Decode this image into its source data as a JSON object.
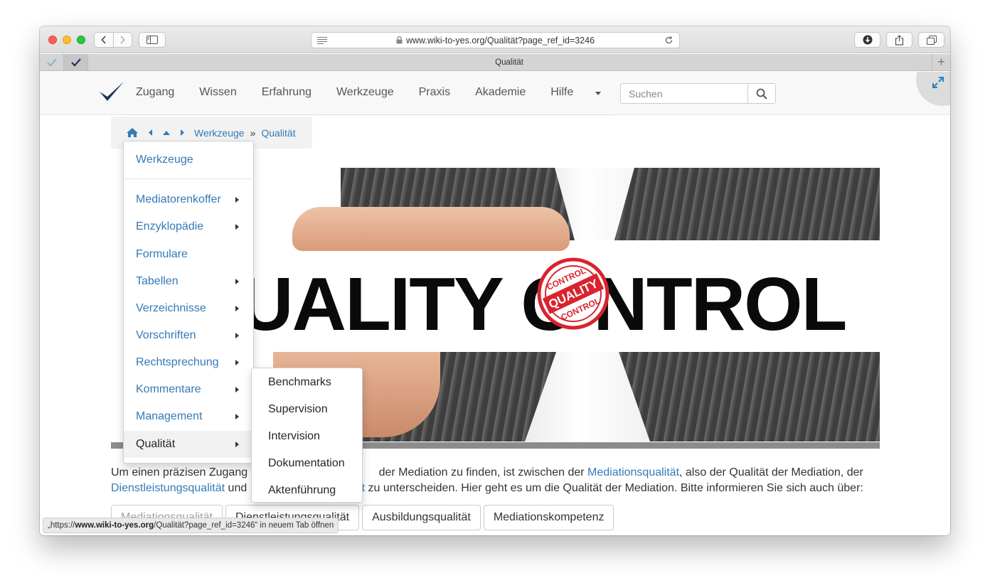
{
  "browser": {
    "url_domain": "www.wiki-to-yes.org",
    "url_path": "/Qualität?page_ref_id=3246",
    "tab_title": "Qualität",
    "new_tab_symbol": "+"
  },
  "site": {
    "menu": [
      "Zugang",
      "Wissen",
      "Erfahrung",
      "Werkzeuge",
      "Praxis",
      "Akademie",
      "Hilfe"
    ],
    "search_placeholder": "Suchen"
  },
  "breadcrumb": {
    "parent": "Werkzeuge",
    "separator": "»",
    "current": "Qualität"
  },
  "dropdown": {
    "header": "Werkzeuge",
    "items": [
      {
        "label": "Mediatorenkoffer",
        "has_submenu": true
      },
      {
        "label": "Enzyklopädie",
        "has_submenu": true
      },
      {
        "label": "Formulare",
        "has_submenu": false
      },
      {
        "label": "Tabellen",
        "has_submenu": true
      },
      {
        "label": "Verzeichnisse",
        "has_submenu": true
      },
      {
        "label": "Vorschriften",
        "has_submenu": true
      },
      {
        "label": "Rechtsprechung",
        "has_submenu": true
      },
      {
        "label": "Kommentare",
        "has_submenu": true
      },
      {
        "label": "Management",
        "has_submenu": true
      },
      {
        "label": "Qualität",
        "has_submenu": true,
        "active": true
      }
    ]
  },
  "submenu": {
    "items": [
      "Benchmarks",
      "Supervision",
      "Intervision",
      "Dokumentation",
      "Aktenführung"
    ]
  },
  "banner": {
    "text": "UALITY C  NTROL",
    "stamp_words": [
      "CONTROL",
      "QUALITY",
      "CONTROL"
    ],
    "stamp_color": "#d9232e"
  },
  "body": {
    "p1_a": "Um einen präzisen Zugang z",
    "p1_b": "der Mediation zu finden, ist zwischen der ",
    "link_mediationsqualitaet": "Mediationsqualität",
    "p1_c": ", also der Qualität der Mediation, der",
    "link_dienstleistungsqualitaet": "Dienstleistungsqualität",
    "p2_a": " und ",
    "link_partial": "ät",
    "p2_b": " zu unterscheiden. Hier geht es um die Qualität der Mediation. Bitte informieren Sie sich auch über:"
  },
  "buttons": [
    "Mediationsqualität",
    "Dienstleistungsqualität",
    "Ausbildungsqualität",
    "Mediationskompetenz"
  ],
  "statusbar": {
    "prefix": "„https://",
    "domain": "www.wiki-to-yes.org",
    "rest": "/Qualität?page_ref_id=3246“ in neuem Tab öffnen"
  },
  "colors": {
    "link": "#337ab7",
    "logo": "#1d3557"
  }
}
